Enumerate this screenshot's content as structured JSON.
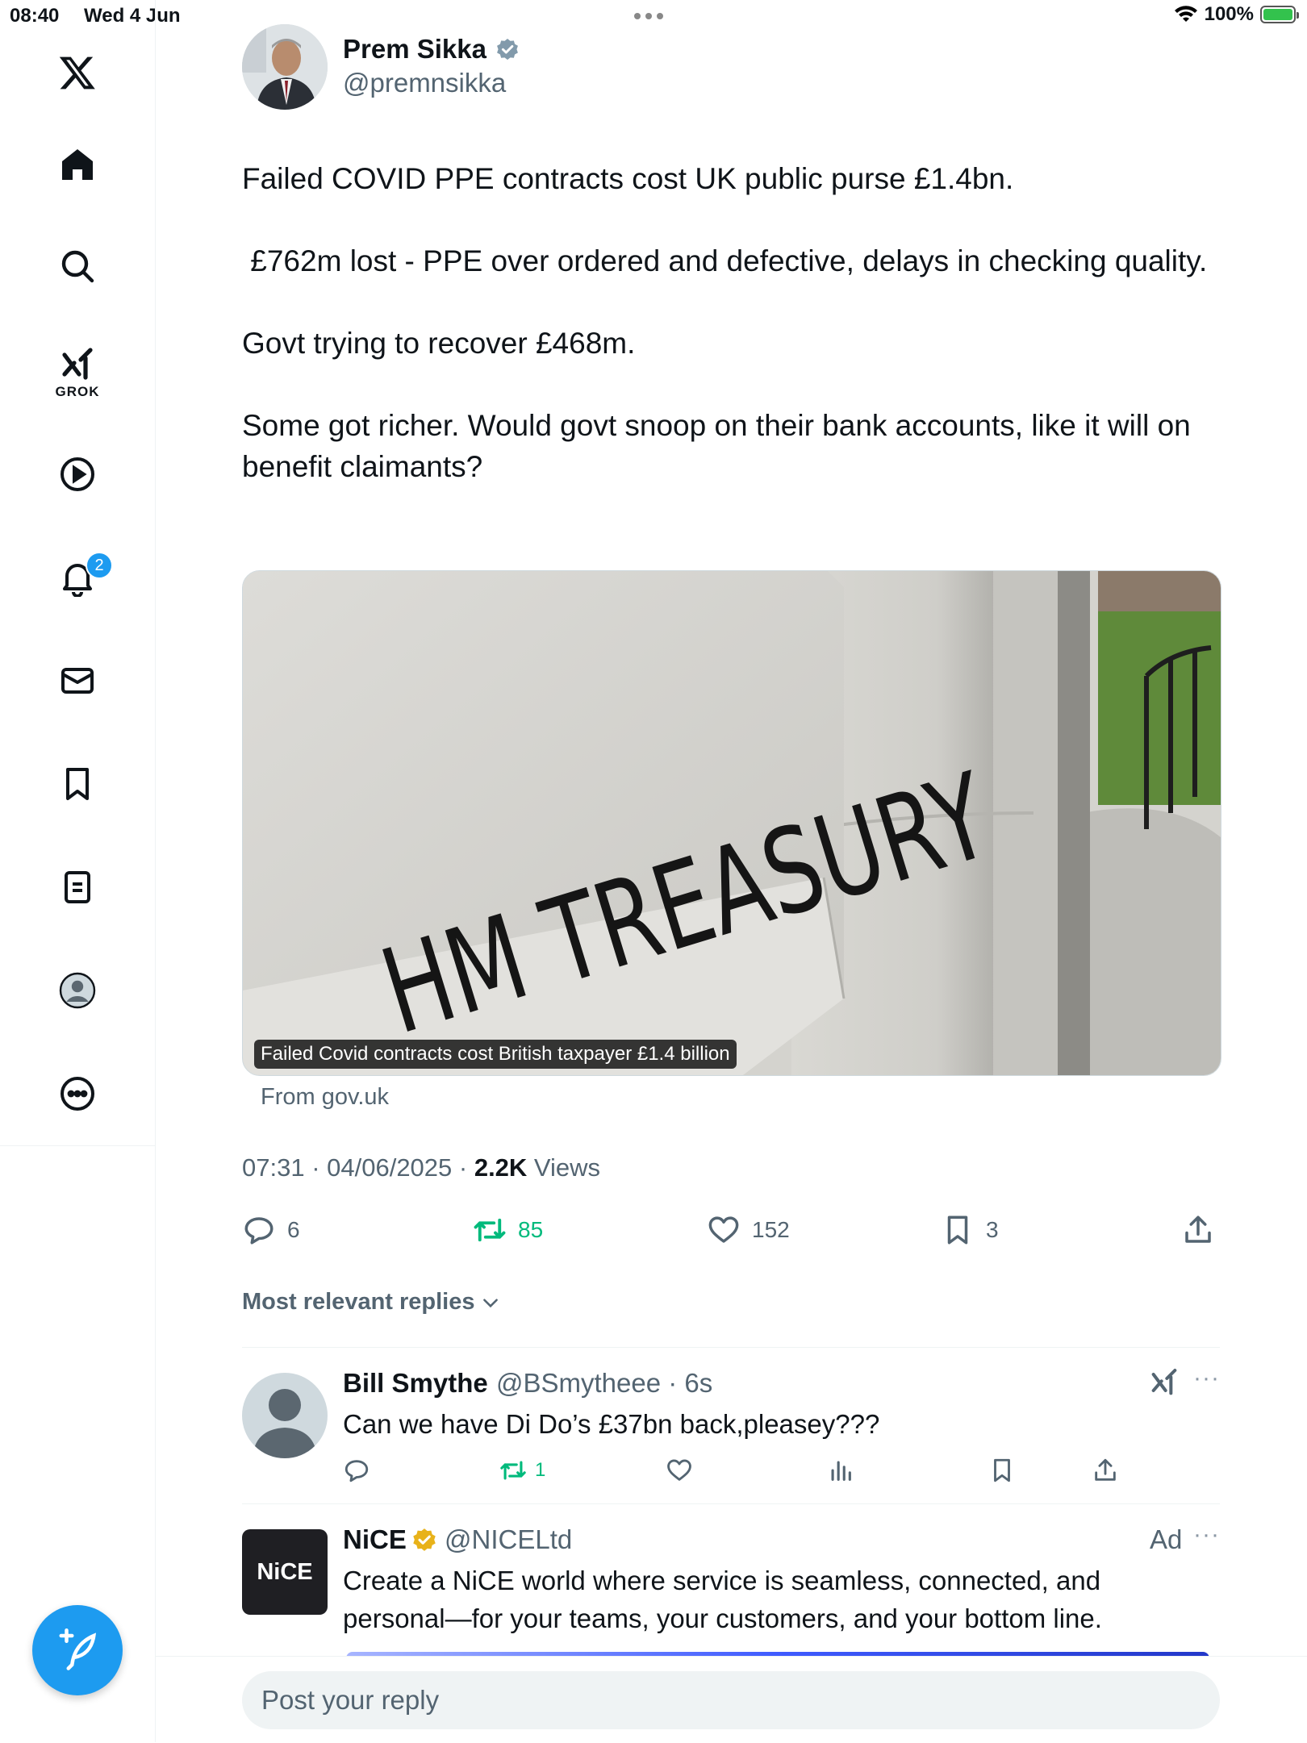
{
  "status_bar": {
    "time": "08:40",
    "date": "Wed 4 Jun",
    "battery": "100%"
  },
  "sidebar": {
    "grok_label": "GROK",
    "notifications_count": "2"
  },
  "tweet": {
    "author_name": "Prem Sikka",
    "author_handle": "@premnsikka",
    "paragraphs": [
      "Failed COVID PPE contracts cost UK public purse £1.4bn.",
      " £762m lost - PPE over ordered and defective, delays in checking quality.",
      "Govt trying to recover £468m.",
      "Some got richer. Would govt snoop on their bank accounts, like it will on benefit claimants?"
    ],
    "card": {
      "sign_text": "HM TREASURY",
      "caption": "Failed Covid contracts cost British taxpayer £1.4 billion",
      "source": "From gov.uk"
    },
    "timestamp": "07:31 · 04/06/2025 · ",
    "views_count": "2.2K",
    "views_label": " Views",
    "stats": {
      "replies": "6",
      "reposts": "85",
      "likes": "152",
      "bookmarks": "3"
    }
  },
  "replies_sort_label": "Most relevant replies",
  "replies": [
    {
      "name": "Bill Smythe",
      "handle_time": "@BSmytheee · 6s",
      "text": "Can we have Di Do’s £37bn back,pleasey???",
      "reposts": "1"
    }
  ],
  "ad": {
    "name": "NiCE",
    "handle": "@NICELtd",
    "label": "Ad",
    "logo_text": "NiCE",
    "text": "Create a NiCE world where service is seamless, connected, and personal—for your teams, your customers, and your bottom line."
  },
  "reply_bar": {
    "placeholder": "Post your reply"
  },
  "colors": {
    "accent": "#1d9bf0",
    "repost_green": "#00ba7c",
    "muted_text": "#536471",
    "verified_gold": "#e8b21a"
  }
}
